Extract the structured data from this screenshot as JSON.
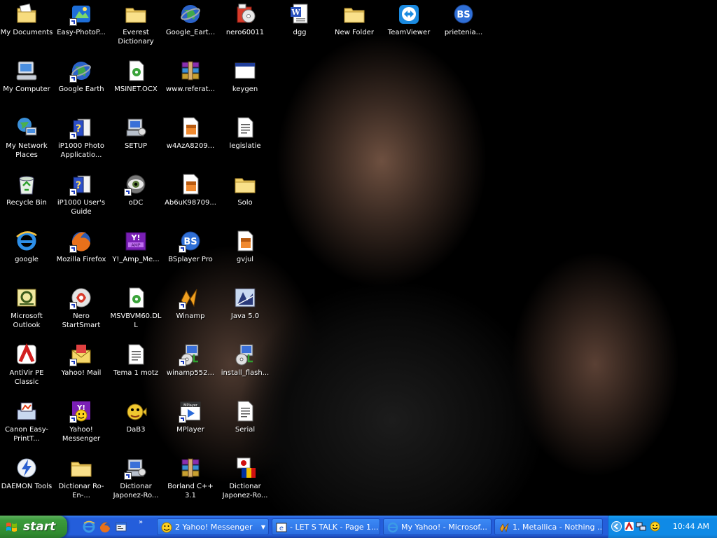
{
  "desktop_icons": [
    {
      "label": "My Documents",
      "icon": "my-documents-icon",
      "shortcut": false
    },
    {
      "label": "Easy-PhotoP...",
      "icon": "easy-photoprint-icon",
      "shortcut": true
    },
    {
      "label": "Everest Dictionary",
      "icon": "folder-icon",
      "shortcut": false
    },
    {
      "label": "Google_Eart...",
      "icon": "google-earth-icon",
      "shortcut": false
    },
    {
      "label": "nero60011",
      "icon": "nero-installer-icon",
      "shortcut": false
    },
    {
      "label": "dgg",
      "icon": "word-document-icon",
      "shortcut": false
    },
    {
      "label": "New Folder",
      "icon": "folder-icon",
      "shortcut": false
    },
    {
      "label": "TeamViewer",
      "icon": "teamviewer-icon",
      "shortcut": false
    },
    {
      "label": "prietenia...",
      "icon": "bsplayer-icon",
      "shortcut": false
    },
    {
      "label": "My Computer",
      "icon": "my-computer-icon",
      "shortcut": false
    },
    {
      "label": "Google Earth",
      "icon": "google-earth-icon",
      "shortcut": true
    },
    {
      "label": "MSINET.OCX",
      "icon": "system-file-icon",
      "shortcut": false
    },
    {
      "label": "www.referat...",
      "icon": "winrar-icon",
      "shortcut": false
    },
    {
      "label": "keygen",
      "icon": "application-window-icon",
      "shortcut": false
    },
    {
      "label": "My Network Places",
      "icon": "network-places-icon",
      "shortcut": false
    },
    {
      "label": "iP1000 Photo Applicatio...",
      "icon": "help-book-icon",
      "shortcut": true
    },
    {
      "label": "SETUP",
      "icon": "setup-icon",
      "shortcut": false
    },
    {
      "label": "w4AzA8209...",
      "icon": "image-file-icon",
      "shortcut": false
    },
    {
      "label": "legislatie",
      "icon": "text-document-icon",
      "shortcut": false
    },
    {
      "label": "Recycle Bin",
      "icon": "recycle-bin-icon",
      "shortcut": false
    },
    {
      "label": "iP1000 User's Guide",
      "icon": "help-book-icon",
      "shortcut": true
    },
    {
      "label": "oDC",
      "icon": "eye-icon",
      "shortcut": true
    },
    {
      "label": "Ab6uK98709...",
      "icon": "image-file-icon",
      "shortcut": false
    },
    {
      "label": "Solo",
      "icon": "folder-icon",
      "shortcut": false
    },
    {
      "label": "google",
      "icon": "internet-explorer-icon",
      "shortcut": false
    },
    {
      "label": "Mozilla Firefox",
      "icon": "firefox-icon",
      "shortcut": true
    },
    {
      "label": "Y!_Amp_Me...",
      "icon": "yahoo-amp-icon",
      "shortcut": false
    },
    {
      "label": "BSplayer Pro",
      "icon": "bsplayer-icon",
      "shortcut": true
    },
    {
      "label": "gvjul",
      "icon": "image-file-icon",
      "shortcut": false
    },
    {
      "label": "Microsoft Outlook",
      "icon": "outlook-icon",
      "shortcut": false
    },
    {
      "label": "Nero StartSmart",
      "icon": "nero-icon",
      "shortcut": true
    },
    {
      "label": "MSVBVM60.DLL",
      "icon": "system-file-icon",
      "shortcut": false
    },
    {
      "label": "Winamp",
      "icon": "winamp-icon",
      "shortcut": true
    },
    {
      "label": "Java 5.0",
      "icon": "java-icon",
      "shortcut": false
    },
    {
      "label": "AntiVir PE Classic",
      "icon": "antivir-icon",
      "shortcut": false
    },
    {
      "label": "Yahoo! Mail",
      "icon": "yahoo-mail-icon",
      "shortcut": true
    },
    {
      "label": "Tema 1 motz",
      "icon": "text-document-icon",
      "shortcut": false
    },
    {
      "label": "winamp552...",
      "icon": "installer-icon",
      "shortcut": true
    },
    {
      "label": "install_flash...",
      "icon": "installer-icon",
      "shortcut": false
    },
    {
      "label": "Canon Easy-PrintT...",
      "icon": "canon-icon",
      "shortcut": false
    },
    {
      "label": "Yahoo! Messenger",
      "icon": "yahoo-messenger-icon",
      "shortcut": true
    },
    {
      "label": "DaB3",
      "icon": "pufferfish-icon",
      "shortcut": false
    },
    {
      "label": "MPlayer",
      "icon": "mplayer-icon",
      "shortcut": true
    },
    {
      "label": "Serial",
      "icon": "text-document-icon",
      "shortcut": false
    },
    {
      "label": "DAEMON Tools",
      "icon": "daemon-tools-icon",
      "shortcut": false
    },
    {
      "label": "Dictionar Ro-En-...",
      "icon": "folder-icon",
      "shortcut": false
    },
    {
      "label": "Dictionar Japonez-Ro...",
      "icon": "setup-icon",
      "shortcut": true
    },
    {
      "label": "Borland C++ 3.1",
      "icon": "winrar-icon",
      "shortcut": false
    },
    {
      "label": "Dictionar Japonez-Ro...",
      "icon": "flags-icon",
      "shortcut": false
    }
  ],
  "taskbar": {
    "start_label": "start",
    "quick_launch": [
      "internet-explorer-icon",
      "firefox-icon",
      "show-desktop-icon"
    ],
    "tasks": [
      {
        "label": "2 Yahoo! Messenger",
        "icon": "yahoo-messenger-icon"
      },
      {
        "label": "- LET S TALK - Page 1...",
        "icon": "internet-explorer-icon"
      },
      {
        "label": "My Yahoo! - Microsof...",
        "icon": "internet-explorer-icon"
      },
      {
        "label": "1. Metallica - Nothing ...",
        "icon": "winamp-icon"
      }
    ],
    "tray_icons": [
      "expand-tray-icon",
      "antivir-tray-icon",
      "network-tray-icon",
      "yahoo-messenger-tray-icon"
    ],
    "clock": "10:44 AM"
  }
}
